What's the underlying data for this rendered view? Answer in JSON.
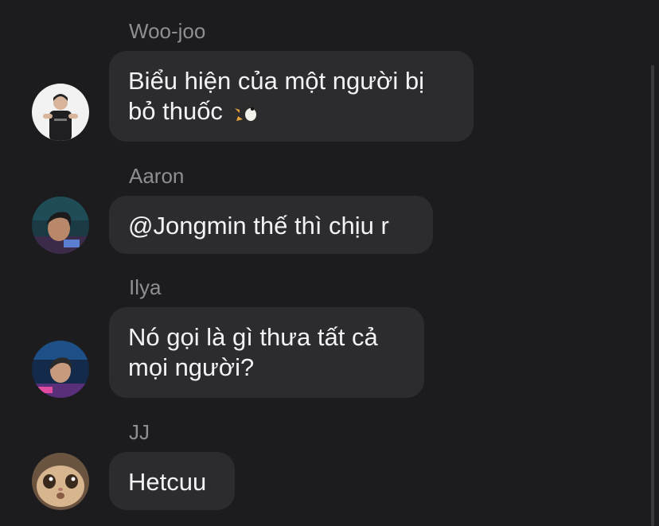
{
  "messages": [
    {
      "sender": "Woo-joo",
      "lines": [
        "Biểu hiện của một người bị",
        "bỏ thuốc"
      ],
      "emoji": "penguin-emoji",
      "avatar": "woo-joo-avatar"
    },
    {
      "sender": "Aaron",
      "lines": [
        "@Jongmin thế thì chịu r"
      ],
      "avatar": "aaron-avatar"
    },
    {
      "sender": "Ilya",
      "lines": [
        "Nó gọi là gì thưa tất cả",
        "mọi người?"
      ],
      "avatar": "ilya-avatar"
    },
    {
      "sender": "JJ",
      "lines": [
        "Hetcuu"
      ],
      "avatar": "jj-avatar"
    }
  ],
  "colors": {
    "background": "#1c1c1e",
    "bubble": "#2c2c2e",
    "sender_text": "#8e8e93",
    "message_text": "#f2f2f7"
  }
}
